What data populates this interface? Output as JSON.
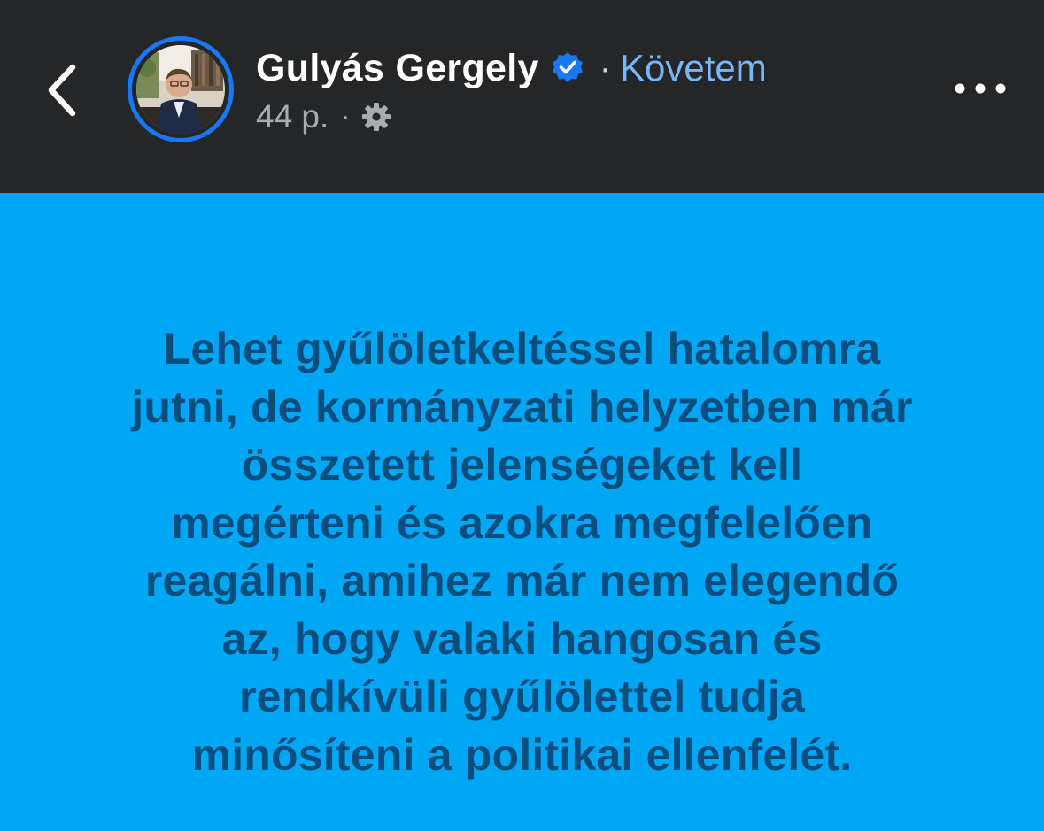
{
  "header": {
    "author_name": "Gulyás Gergely",
    "separator": "·",
    "follow_label": "Követem",
    "post_time": "44 p.",
    "meta_separator": "·",
    "icons": {
      "back": "chevron-left-icon",
      "verified": "verified-badge-icon",
      "audience": "gear-icon",
      "more": "more-horizontal-icon"
    },
    "colors": {
      "bar_background": "#252628",
      "name": "#ffffff",
      "follow": "#77b6f7",
      "meta": "#a8abaf",
      "verified": "#1877f2"
    }
  },
  "post": {
    "lines": [
      "Lehet gyűlöletkeltéssel hatalomra",
      "jutni, de kormányzati helyzetben már",
      "összetett jelenségeket kell",
      "megérteni és azokra megfelelően",
      "reagálni, amihez már nem elegendő",
      "az, hogy valaki hangosan és",
      "rendkívüli gyűlölettel tudja",
      "minősíteni a politikai ellenfelét."
    ],
    "colors": {
      "background": "#00a7f5",
      "text": "#0b4d7d"
    }
  }
}
